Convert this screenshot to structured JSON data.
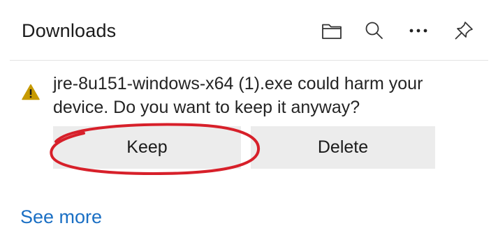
{
  "panel": {
    "title": "Downloads",
    "toolbar": [
      {
        "icon": "folder-icon",
        "label": "Open downloads folder"
      },
      {
        "icon": "search-icon",
        "label": "Search downloads"
      },
      {
        "icon": "more-options-icon",
        "label": "More options"
      },
      {
        "icon": "pin-icon",
        "label": "Pin downloads"
      }
    ]
  },
  "warning": {
    "icon": "warning-icon",
    "message": "jre-8u151-windows-x64 (1).exe could harm your device. Do you want to keep it anyway?",
    "keep_label": "Keep",
    "delete_label": "Delete"
  },
  "footer": {
    "see_more_label": "See more"
  },
  "colors": {
    "accent_link": "#1a6fc4",
    "warning": "#c79a00",
    "annotation": "#d7202a",
    "button_bg": "#ececec"
  }
}
